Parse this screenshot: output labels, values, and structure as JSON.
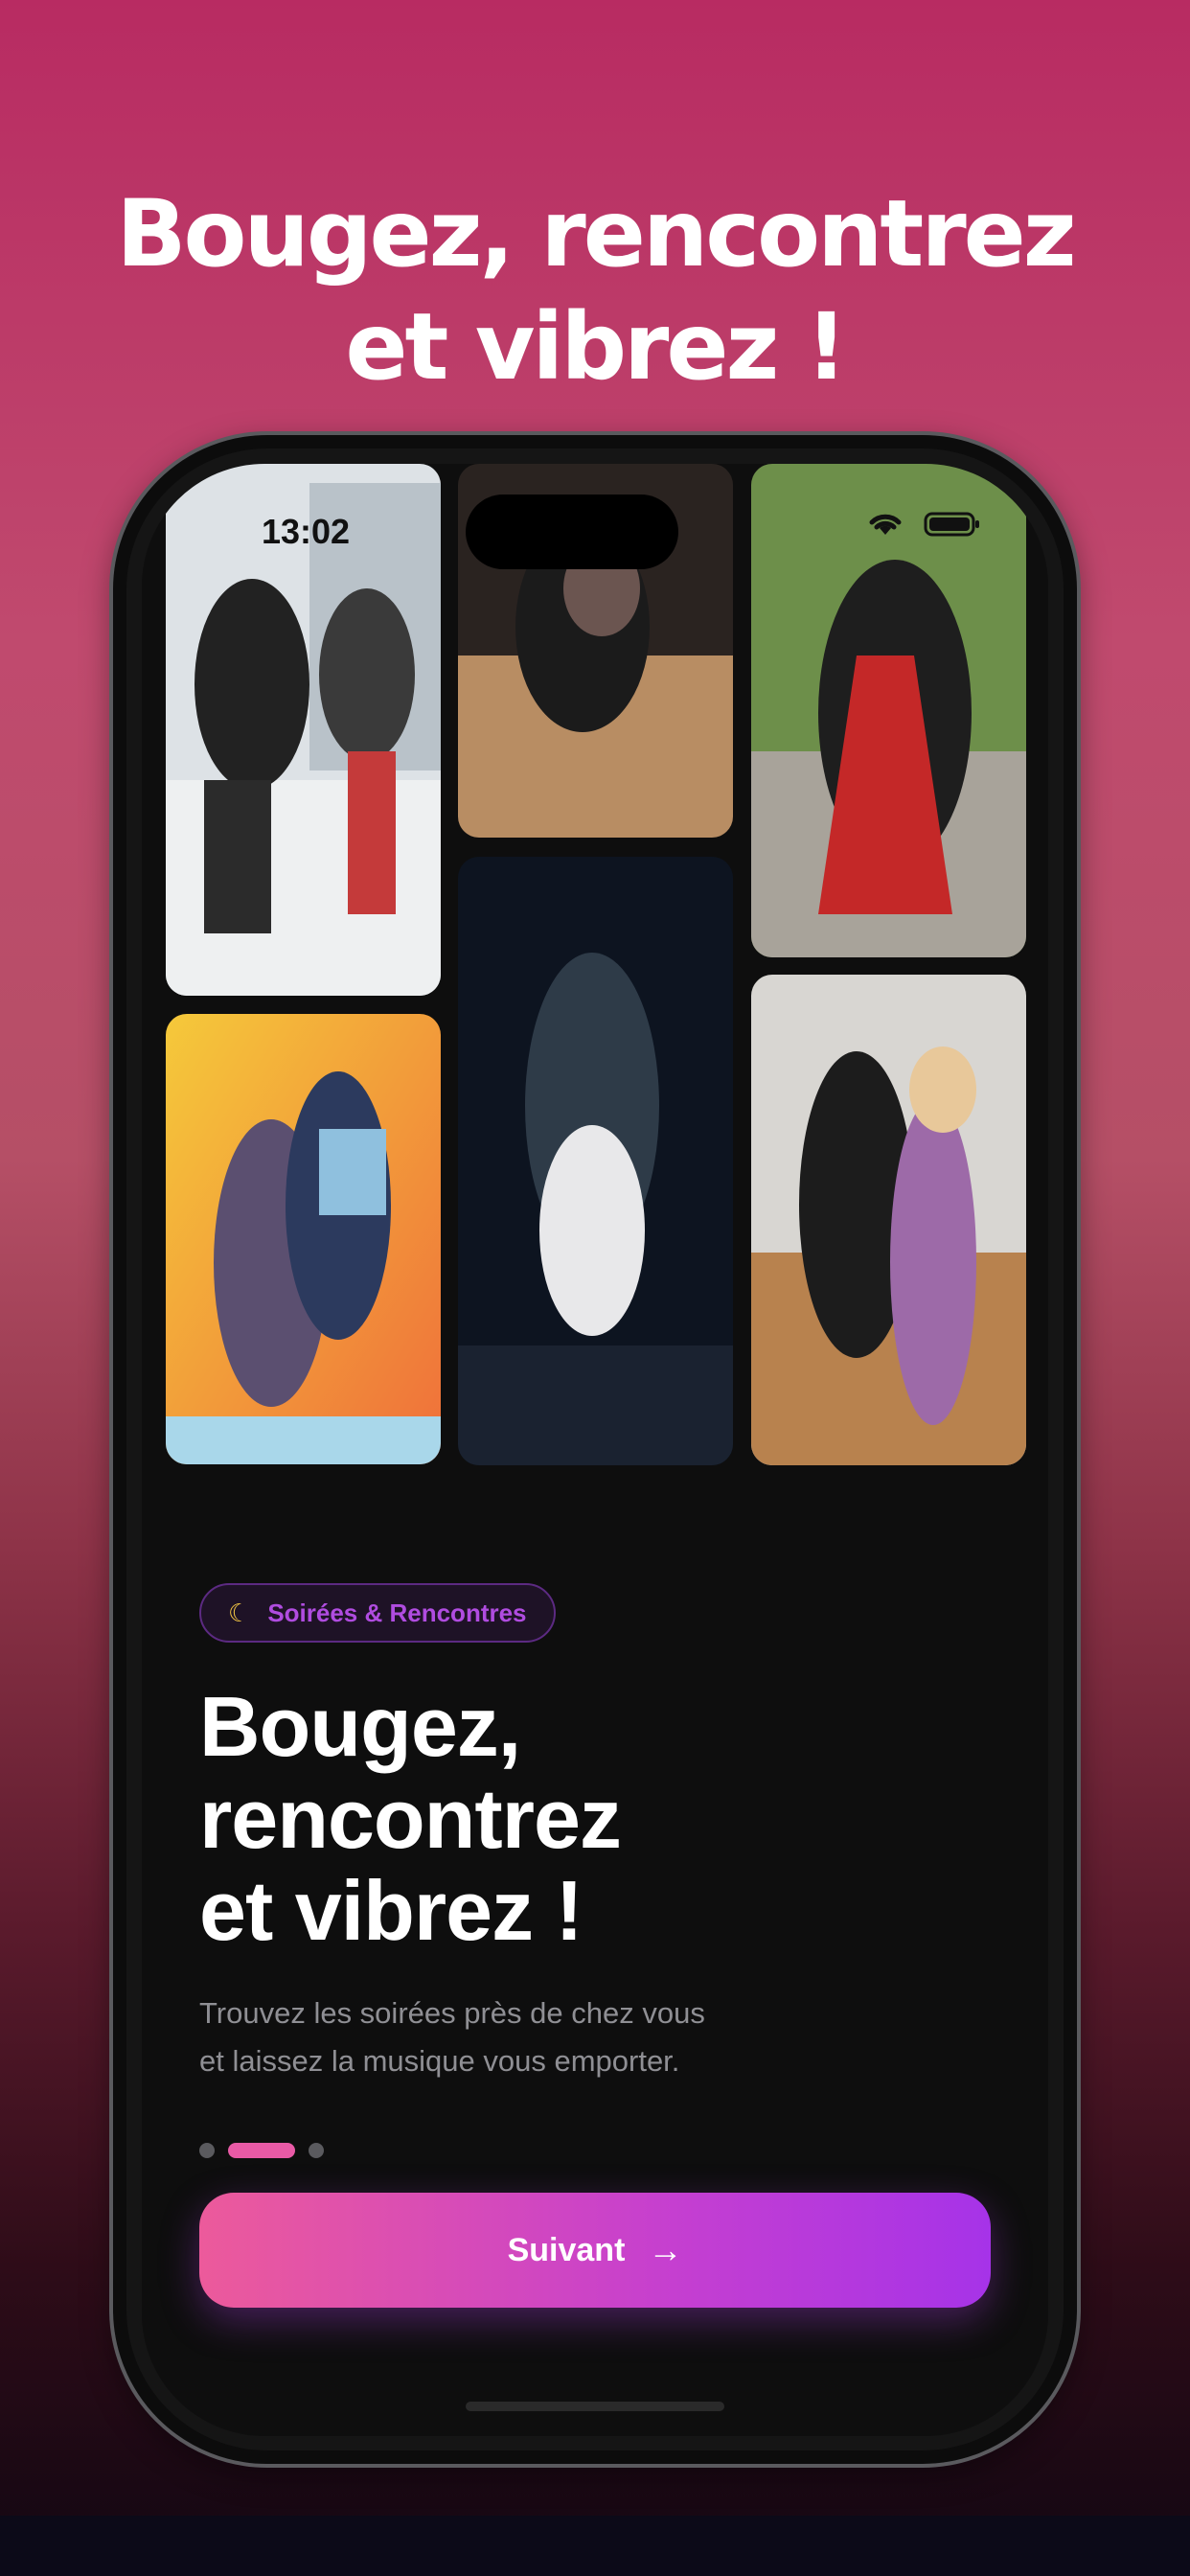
{
  "promo": {
    "headline_line1": "Bougez, rencontrez",
    "headline_line2": "et vibrez !"
  },
  "status_bar": {
    "time": "13:02"
  },
  "onboarding": {
    "badge": {
      "icon": "moon-icon",
      "label": "Soirées & Rencontres"
    },
    "title_lines": [
      "Bougez,",
      "rencontrez",
      "et vibrez !"
    ],
    "subtitle_lines": [
      "Trouvez les soirées près de chez vous",
      "et laissez la musique vous emporter."
    ],
    "pagination": {
      "current_page": 2,
      "total_pages": 3
    },
    "next_button": {
      "label": "Suivant",
      "icon": "arrow-right-icon"
    }
  },
  "colors": {
    "background_top": "#b82b62",
    "accent_pink": "#ec5a9b",
    "accent_purple": "#a633e8",
    "badge_text": "#b04ce0",
    "screen_bg": "#0e0e0e"
  }
}
